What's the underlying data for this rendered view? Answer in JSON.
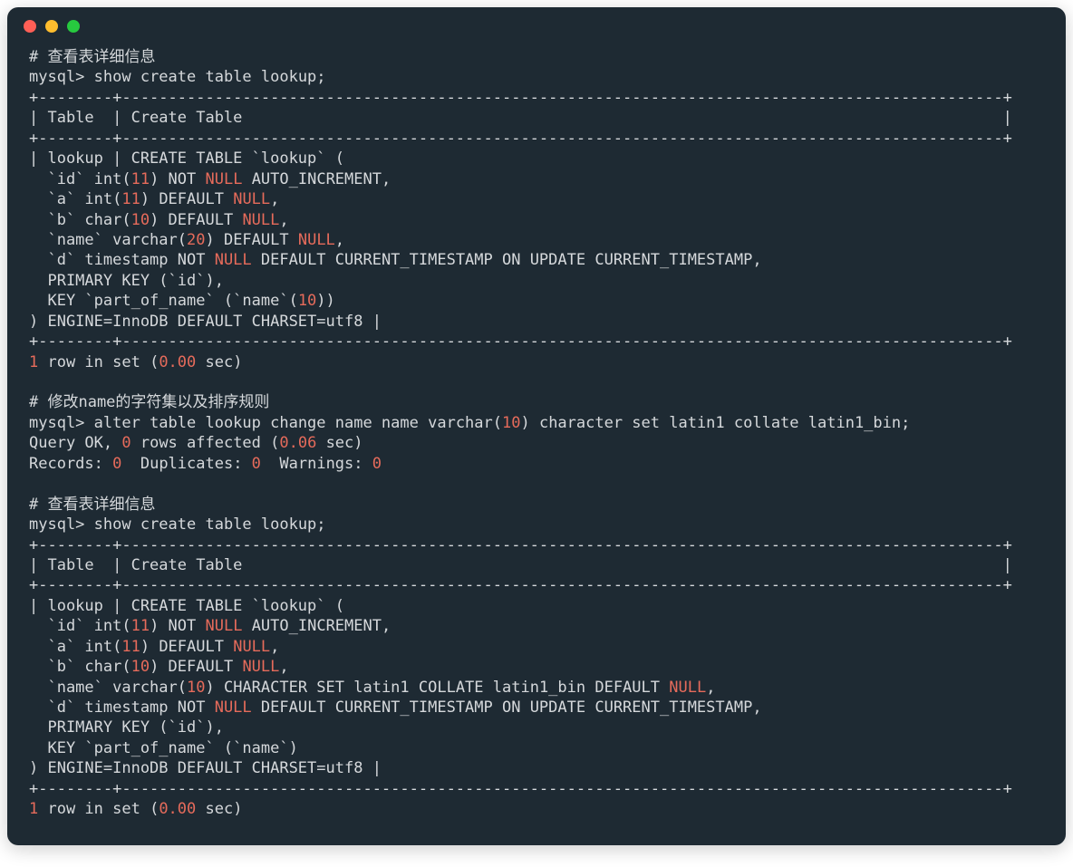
{
  "window": {
    "buttons": [
      "close",
      "minimize",
      "zoom"
    ]
  },
  "section1": {
    "comment": "# 查看表详细信息",
    "prompt": "mysql> ",
    "cmd": "show create table lookup;",
    "border_top": "+--------+-----------------------------------------------------------------------------------------------+",
    "header": "| Table  | Create Table                                                                                  |",
    "border_mid": "+--------+-----------------------------------------------------------------------------------------------+",
    "body_pre": "| lookup | CREATE TABLE `lookup` (",
    "id_a": "  `id` int(",
    "id_n": "11",
    "id_b": ") NOT ",
    "id_null": "NULL",
    "id_c": " AUTO_INCREMENT,",
    "a_a": "  `a` int(",
    "a_n": "11",
    "a_b": ") DEFAULT ",
    "a_null": "NULL",
    "a_c": ",",
    "b_a": "  `b` char(",
    "b_n": "10",
    "b_b": ") DEFAULT ",
    "b_null": "NULL",
    "b_c": ",",
    "n_a": "  `name` varchar(",
    "n_n": "20",
    "n_b": ") DEFAULT ",
    "n_null": "NULL",
    "n_c": ",",
    "d_a": "  `d` timestamp NOT ",
    "d_null": "NULL",
    "d_b": " DEFAULT CURRENT_TIMESTAMP ON UPDATE CURRENT_TIMESTAMP,",
    "pk": "  PRIMARY KEY (`id`),",
    "key_a": "  KEY `part_of_name` (`name`(",
    "key_n": "10",
    "key_b": "))",
    "engine": ") ENGINE=InnoDB DEFAULT CHARSET=utf8 |",
    "border_bot": "+--------+-----------------------------------------------------------------------------------------------+",
    "result_1": "1",
    "result_a": " row in set (",
    "result_time": "0.00",
    "result_b": " sec)"
  },
  "section2": {
    "comment": "# 修改name的字符集以及排序规则",
    "prompt": "mysql> ",
    "cmd_a": "alter table lookup change name name varchar(",
    "cmd_n": "10",
    "cmd_b": ") character set latin1 collate latin1_bin;",
    "qok_a": "Query OK, ",
    "qok_n": "0",
    "qok_b": " rows affected (",
    "qok_t": "0.06",
    "qok_c": " sec)",
    "rec_a": "Records: ",
    "rec_n1": "0",
    "rec_b": "  Duplicates: ",
    "rec_n2": "0",
    "rec_c": "  Warnings: ",
    "rec_n3": "0"
  },
  "section3": {
    "comment": "# 查看表详细信息",
    "prompt": "mysql> ",
    "cmd": "show create table lookup;",
    "border_top": "+--------+-----------------------------------------------------------------------------------------------+",
    "header": "| Table  | Create Table                                                                                  |",
    "border_mid": "+--------+-----------------------------------------------------------------------------------------------+",
    "body_pre": "| lookup | CREATE TABLE `lookup` (",
    "id_a": "  `id` int(",
    "id_n": "11",
    "id_b": ") NOT ",
    "id_null": "NULL",
    "id_c": " AUTO_INCREMENT,",
    "a_a": "  `a` int(",
    "a_n": "11",
    "a_b": ") DEFAULT ",
    "a_null": "NULL",
    "a_c": ",",
    "b_a": "  `b` char(",
    "b_n": "10",
    "b_b": ") DEFAULT ",
    "b_null": "NULL",
    "b_c": ",",
    "n_a": "  `name` varchar(",
    "n_n": "10",
    "n_b": ") CHARACTER SET latin1 COLLATE latin1_bin DEFAULT ",
    "n_null": "NULL",
    "n_c": ",",
    "d_a": "  `d` timestamp NOT ",
    "d_null": "NULL",
    "d_b": " DEFAULT CURRENT_TIMESTAMP ON UPDATE CURRENT_TIMESTAMP,",
    "pk": "  PRIMARY KEY (`id`),",
    "key": "  KEY `part_of_name` (`name`)",
    "engine": ") ENGINE=InnoDB DEFAULT CHARSET=utf8 |",
    "border_bot": "+--------+-----------------------------------------------------------------------------------------------+",
    "result_1": "1",
    "result_a": " row in set (",
    "result_time": "0.00",
    "result_b": " sec)"
  }
}
